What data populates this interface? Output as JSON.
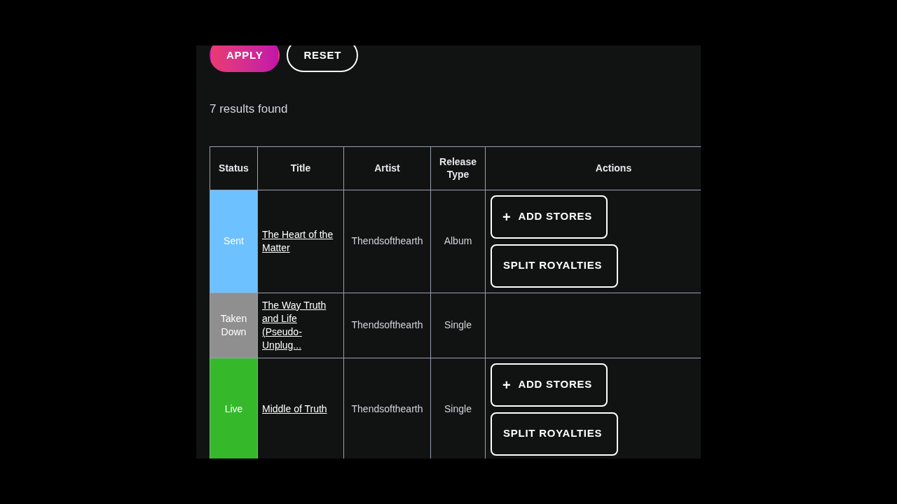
{
  "filters": {
    "buttons": [
      {
        "kind": "primary",
        "label": "APPLY"
      },
      {
        "kind": "outline",
        "label": "RESET"
      }
    ]
  },
  "results_count": "7 results found",
  "table": {
    "columns": [
      "Status",
      "Title",
      "Artist",
      "Release Type",
      "Actions"
    ],
    "rows": [
      {
        "status": "Sent",
        "color": "#6ec1ff",
        "title": "The Heart of the Matter",
        "artist": "Thendsofthearth",
        "release_type": "Album",
        "actions": [
          {
            "kind": "add",
            "icon": "+",
            "label": "ADD STORES"
          },
          {
            "kind": "plain",
            "label": "SPLIT ROYALTIES"
          }
        ]
      },
      {
        "status": "Taken Down",
        "color": "#8f8f8f",
        "title": "The Way Truth and Life (Pseudo-Unplug...",
        "artist": "Thendsofthearth",
        "release_type": "Single",
        "actions": []
      },
      {
        "status": "Live",
        "color": "#35b92a",
        "title": "Middle of Truth",
        "artist": "Thendsofthearth",
        "release_type": "Single",
        "actions": [
          {
            "kind": "add",
            "icon": "+",
            "label": "ADD STORES"
          },
          {
            "kind": "plain",
            "label": "SPLIT ROYALTIES"
          }
        ]
      }
    ]
  }
}
